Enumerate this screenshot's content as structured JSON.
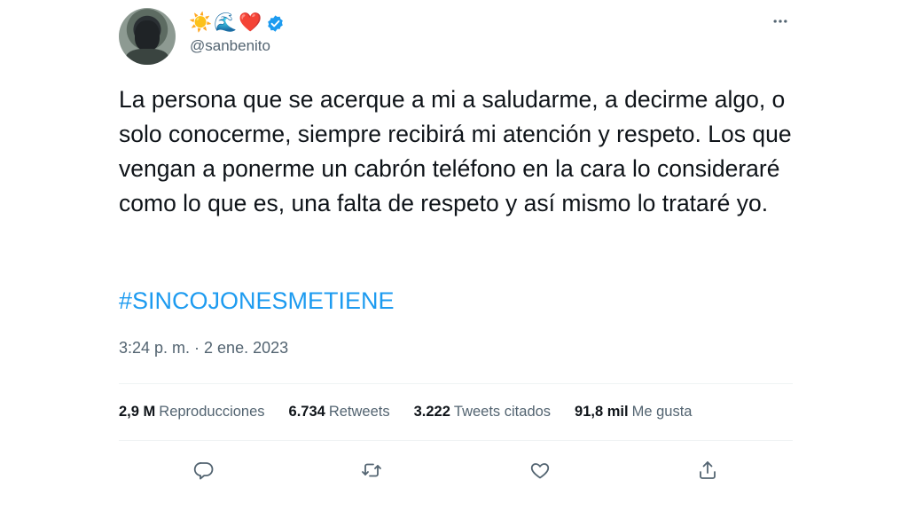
{
  "user": {
    "name_emojis": [
      "☀️",
      "🌊",
      "❤️"
    ],
    "handle": "@sanbenito",
    "verified": true
  },
  "tweet": {
    "text": "La persona que se acerque a mi a saludarme, a decirme algo, o solo conocerme, siempre recibirá mi atención y respeto. Los que vengan a ponerme un cabrón teléfono en la cara lo consideraré como lo que es, una falta de respeto y así mismo lo trataré yo.",
    "hashtag": "#SINCOJONESMETIENE",
    "timestamp": "3:24 p. m. · 2 ene. 2023"
  },
  "stats": [
    {
      "count": "2,9 M",
      "label": "Reproducciones"
    },
    {
      "count": "6.734",
      "label": "Retweets"
    },
    {
      "count": "3.222",
      "label": "Tweets citados"
    },
    {
      "count": "91,8 mil",
      "label": "Me gusta"
    }
  ],
  "icons": {
    "more": "more-horizontal-icon",
    "reply": "reply-icon",
    "retweet": "retweet-icon",
    "like": "heart-icon",
    "share": "share-icon",
    "verified": "verified-badge-icon"
  },
  "colors": {
    "accent": "#1d9bf0",
    "text": "#0f1419",
    "secondary": "#536471"
  }
}
